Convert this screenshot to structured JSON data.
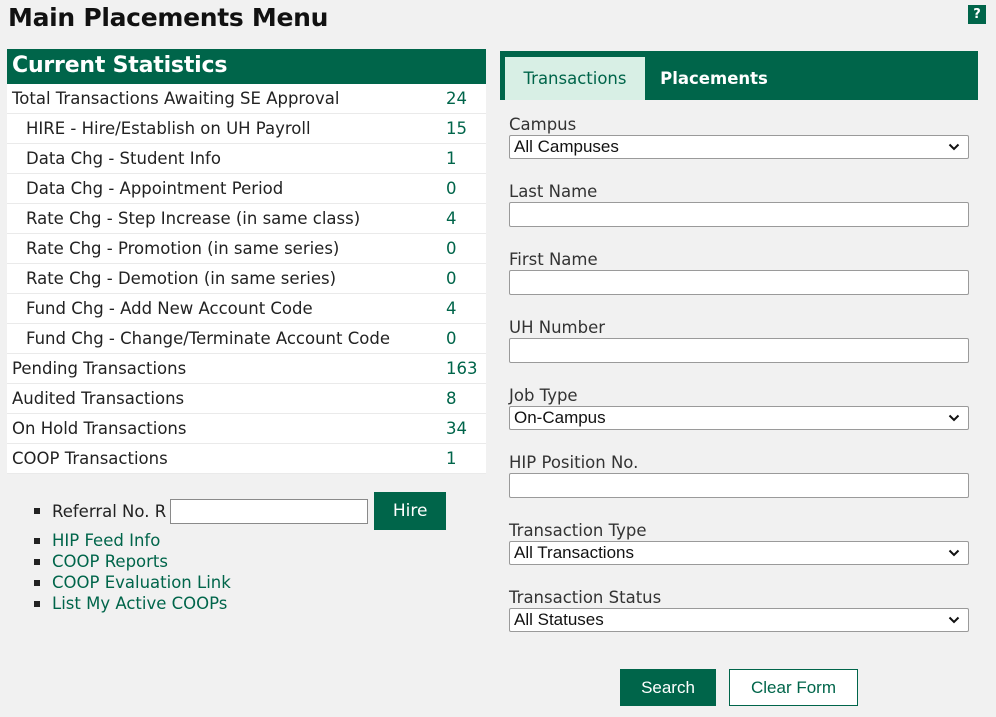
{
  "page": {
    "title": "Main Placements Menu",
    "help": "?"
  },
  "stats": {
    "header": "Current Statistics",
    "rows": [
      {
        "label": "Total Transactions Awaiting SE Approval",
        "value": "24"
      },
      {
        "label": "HIRE - Hire/Establish on UH Payroll",
        "value": "15"
      },
      {
        "label": "Data Chg - Student Info",
        "value": "1"
      },
      {
        "label": "Data Chg - Appointment Period",
        "value": "0"
      },
      {
        "label": "Rate Chg - Step Increase (in same class)",
        "value": "4"
      },
      {
        "label": "Rate Chg - Promotion (in same series)",
        "value": "0"
      },
      {
        "label": "Rate Chg - Demotion (in same series)",
        "value": "0"
      },
      {
        "label": "Fund Chg - Add New Account Code",
        "value": "4"
      },
      {
        "label": "Fund Chg - Change/Terminate Account Code",
        "value": "0"
      },
      {
        "label": "Pending Transactions",
        "value": "163"
      },
      {
        "label": "Audited Transactions",
        "value": "8"
      },
      {
        "label": "On Hold Transactions",
        "value": "34"
      },
      {
        "label": "COOP Transactions",
        "value": "1"
      }
    ]
  },
  "links": {
    "referral_label": "Referral No. R",
    "referral_value": "",
    "hire_label": "Hire",
    "items": [
      "HIP Feed Info",
      "COOP Reports",
      "COOP Evaluation Link",
      "List My Active COOPs"
    ]
  },
  "search": {
    "tabs": [
      "Transactions",
      "Placements"
    ],
    "campus_label": "Campus",
    "campus_value": "All Campuses",
    "last_name_label": "Last Name",
    "first_name_label": "First Name",
    "uh_number_label": "UH Number",
    "job_type_label": "Job Type",
    "job_type_value": "On-Campus",
    "hip_position_label": "HIP Position No.",
    "transaction_type_label": "Transaction Type",
    "transaction_type_value": "All Transactions",
    "transaction_status_label": "Transaction Status",
    "transaction_status_value": "All Statuses",
    "search_label": "Search",
    "clear_label": "Clear Form"
  },
  "colors": {
    "brand": "#00654a",
    "tab_active_bg": "#d8efe5",
    "page_bg": "#f1f1f1"
  },
  "icons": {
    "help": "question-icon",
    "dropdown": "chevron-down-icon",
    "list_bullet": "square-bullet-icon"
  }
}
